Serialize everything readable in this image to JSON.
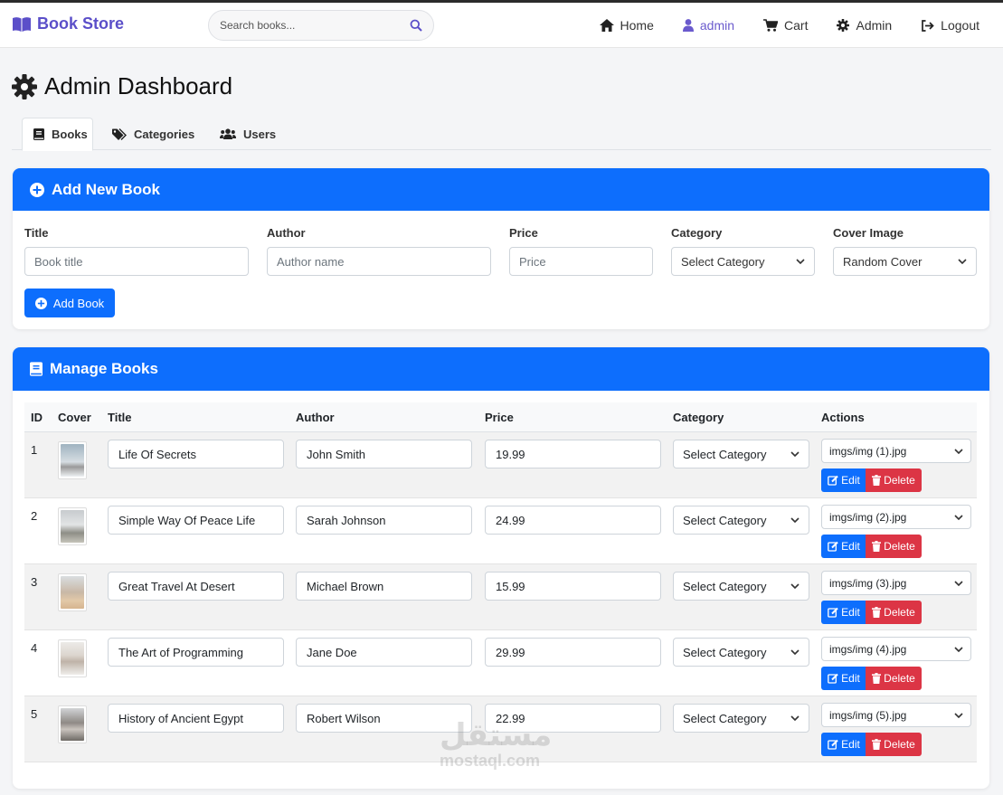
{
  "navbar": {
    "brand": "Book Store",
    "search_placeholder": "Search books...",
    "links": [
      {
        "label": "Home",
        "icon": "home-icon"
      },
      {
        "label": "admin",
        "icon": "user-icon",
        "active": true
      },
      {
        "label": "Cart",
        "icon": "cart-icon"
      },
      {
        "label": "Admin",
        "icon": "gear-icon"
      },
      {
        "label": "Logout",
        "icon": "logout-icon"
      }
    ]
  },
  "page": {
    "title": "Admin Dashboard"
  },
  "tabs": [
    {
      "label": "Books",
      "icon": "book-icon",
      "active": true
    },
    {
      "label": "Categories",
      "icon": "tags-icon"
    },
    {
      "label": "Users",
      "icon": "users-icon"
    }
  ],
  "add_book": {
    "header": "Add New Book",
    "title_label": "Title",
    "title_placeholder": "Book title",
    "author_label": "Author",
    "author_placeholder": "Author name",
    "price_label": "Price",
    "price_placeholder": "Price",
    "category_label": "Category",
    "category_value": "Select Category",
    "cover_label": "Cover Image",
    "cover_value": "Random Cover",
    "submit_label": "Add Book"
  },
  "manage_books": {
    "header": "Manage Books",
    "columns": [
      "ID",
      "Cover",
      "Title",
      "Author",
      "Price",
      "Category",
      "Actions"
    ],
    "edit_label": "Edit",
    "delete_label": "Delete",
    "rows": [
      {
        "id": "1",
        "title": "Life Of Secrets",
        "author": "John Smith",
        "price": "19.99",
        "category": "Select Category",
        "image": "imgs/img (1).jpg"
      },
      {
        "id": "2",
        "title": "Simple Way Of Peace Life",
        "author": "Sarah Johnson",
        "price": "24.99",
        "category": "Select Category",
        "image": "imgs/img (2).jpg"
      },
      {
        "id": "3",
        "title": "Great Travel At Desert",
        "author": "Michael Brown",
        "price": "15.99",
        "category": "Select Category",
        "image": "imgs/img (3).jpg"
      },
      {
        "id": "4",
        "title": "The Art of Programming",
        "author": "Jane Doe",
        "price": "29.99",
        "category": "Select Category",
        "image": "imgs/img (4).jpg"
      },
      {
        "id": "5",
        "title": "History of Ancient Egypt",
        "author": "Robert Wilson",
        "price": "22.99",
        "category": "Select Category",
        "image": "imgs/img (5).jpg"
      }
    ]
  },
  "watermark": {
    "arabic": "مستقل",
    "latin": "mostaql.com"
  },
  "colors": {
    "primary": "#0d6efd",
    "danger": "#dc3545",
    "brand": "#5b4fc9",
    "active_link": "#6a5acd"
  }
}
